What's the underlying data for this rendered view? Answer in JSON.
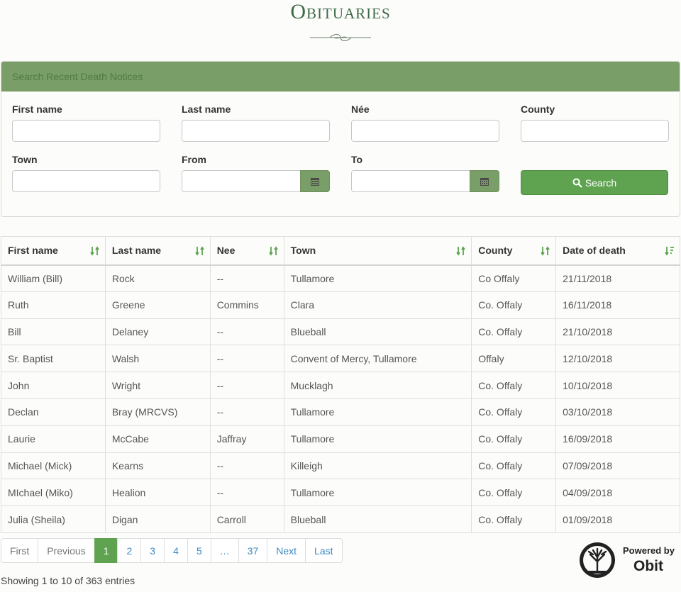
{
  "page": {
    "title": "Obituaries"
  },
  "search_panel": {
    "heading": "Search Recent Death Notices",
    "fields": {
      "first_name": {
        "label": "First name",
        "value": ""
      },
      "last_name": {
        "label": "Last name",
        "value": ""
      },
      "nee": {
        "label": "Née",
        "value": ""
      },
      "county": {
        "label": "County",
        "value": ""
      },
      "town": {
        "label": "Town",
        "value": ""
      },
      "from": {
        "label": "From",
        "value": ""
      },
      "to": {
        "label": "To",
        "value": ""
      }
    },
    "search_button": "Search"
  },
  "table": {
    "columns": [
      "First name",
      "Last name",
      "Nee",
      "Town",
      "County",
      "Date of death"
    ],
    "rows": [
      [
        "William (Bill)",
        "Rock",
        "--",
        "Tullamore",
        "Co Offaly",
        "21/11/2018"
      ],
      [
        "Ruth",
        "Greene",
        "Commins",
        "Clara",
        "Co. Offaly",
        "16/11/2018"
      ],
      [
        "Bill",
        "Delaney",
        "--",
        "Blueball",
        "Co. Offaly",
        "21/10/2018"
      ],
      [
        "Sr. Baptist",
        "Walsh",
        "--",
        "Convent of Mercy, Tullamore",
        "Offaly",
        "12/10/2018"
      ],
      [
        "John",
        "Wright",
        "--",
        "Mucklagh",
        "Co. Offaly",
        "10/10/2018"
      ],
      [
        "Declan",
        "Bray (MRCVS)",
        "--",
        "Tullamore",
        "Co. Offaly",
        "03/10/2018"
      ],
      [
        "Laurie",
        "McCabe",
        "Jaffray",
        "Tullamore",
        "Co. Offaly",
        "16/09/2018"
      ],
      [
        "Michael (Mick)",
        "Kearns",
        "--",
        "Killeigh",
        "Co. Offaly",
        "07/09/2018"
      ],
      [
        "MIchael (Miko)",
        "Healion",
        "--",
        "Tullamore",
        "Co. Offaly",
        "04/09/2018"
      ],
      [
        "Julia (Sheila)",
        "Digan",
        "Carroll",
        "Blueball",
        "Co. Offaly",
        "01/09/2018"
      ]
    ]
  },
  "pagination": {
    "items": [
      "First",
      "Previous",
      "1",
      "2",
      "3",
      "4",
      "5",
      "…",
      "37",
      "Next",
      "Last"
    ],
    "active": "1"
  },
  "info": "Showing 1 to 10 of 363 entries",
  "powered": {
    "by": "Powered by",
    "brand": "Obit"
  },
  "colors": {
    "accent_green": "#5fa351",
    "panel_green": "#7a9e67",
    "title_green": "#3e6a47"
  },
  "icons": {
    "calendar": "calendar-icon",
    "search": "search-icon",
    "sort": "sort-icon",
    "sort_desc": "sort-desc-icon"
  }
}
